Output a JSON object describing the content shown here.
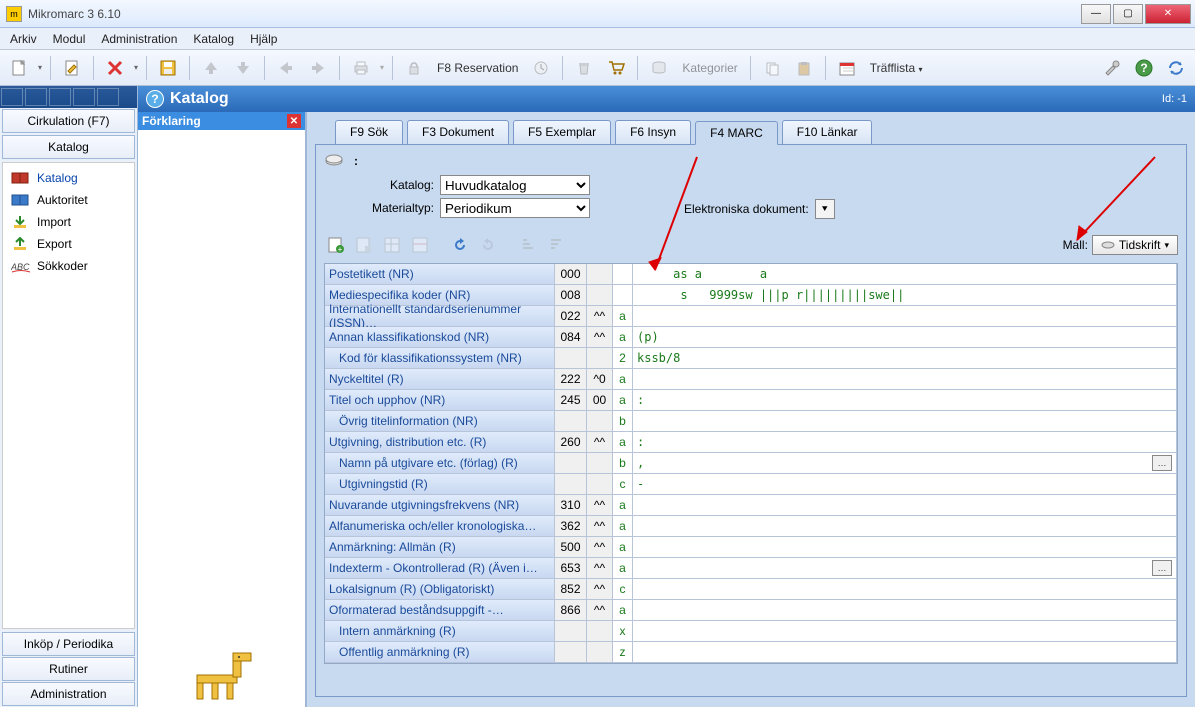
{
  "window": {
    "title": "Mikromarc 3 6.10",
    "id_label": "Id: -1"
  },
  "menu": [
    "Arkiv",
    "Modul",
    "Administration",
    "Katalog",
    "Hjälp"
  ],
  "toolbar": {
    "f8_reservation": "F8 Reservation",
    "kategorier": "Kategorier",
    "trafflista": "Träfflista"
  },
  "sidebar": {
    "tabs": {
      "cirkulation": "Cirkulation (F7)",
      "katalog": "Katalog"
    },
    "items": [
      {
        "label": "Katalog",
        "color": "#c0392b"
      },
      {
        "label": "Auktoritet",
        "color": "#2a6ab8"
      },
      {
        "label": "Import",
        "color": "#2a8a2a"
      },
      {
        "label": "Export",
        "color": "#2a8a2a"
      },
      {
        "label": "Sökkoder",
        "color": "#666"
      }
    ],
    "footer": [
      "Inköp / Periodika",
      "Rutiner",
      "Administration"
    ]
  },
  "help_panel": {
    "title": "Förklaring"
  },
  "content": {
    "heading": "Katalog",
    "tabs": [
      "F9 Sök",
      "F3 Dokument",
      "F5 Exemplar",
      "F6 Insyn",
      "F4 MARC",
      "F10 Länkar"
    ],
    "active_tab": 4,
    "meta": {
      "katalog_label": "Katalog:",
      "katalog_value": "Huvudkatalog",
      "materialtyp_label": "Materialtyp:",
      "materialtyp_value": "Periodikum",
      "elec_doc_label": "Elektroniska dokument:"
    },
    "mall": {
      "label": "Mall:",
      "value": "Tidskrift"
    }
  },
  "marc_rows": [
    {
      "label": "Postetikett (NR)",
      "tag": "000",
      "ind": "",
      "sf": "",
      "val": "     as a        a"
    },
    {
      "label": "Mediespecifika koder (NR)",
      "tag": "008",
      "ind": "",
      "sf": "",
      "val": "      s   9999sw |||p r|||||||||swe||"
    },
    {
      "label": "Internationellt standardserienummer (ISSN)…",
      "tag": "022",
      "ind": "^^",
      "sf": "a",
      "val": ""
    },
    {
      "label": "Annan klassifikationskod (NR)",
      "tag": "084",
      "ind": "^^",
      "sf": "a",
      "val": "(p)"
    },
    {
      "label": "Kod för klassifikationssystem (NR)",
      "sub": true,
      "tag": "",
      "ind": "",
      "sf": "2",
      "val": "kssb/8"
    },
    {
      "label": "Nyckeltitel (R)",
      "tag": "222",
      "ind": "^0",
      "sf": "a",
      "val": ""
    },
    {
      "label": "Titel och upphov (NR)",
      "tag": "245",
      "ind": "00",
      "sf": "a",
      "val": ":"
    },
    {
      "label": "Övrig titelinformation (NR)",
      "sub": true,
      "tag": "",
      "ind": "",
      "sf": "b",
      "val": ""
    },
    {
      "label": "Utgivning, distribution etc. (R)",
      "tag": "260",
      "ind": "^^",
      "sf": "a",
      "val": ":"
    },
    {
      "label": "Namn på utgivare etc. (förlag) (R)",
      "sub": true,
      "tag": "",
      "ind": "",
      "sf": "b",
      "val": ",",
      "ellipsis": true
    },
    {
      "label": "Utgivningstid (R)",
      "sub": true,
      "tag": "",
      "ind": "",
      "sf": "c",
      "val": "-"
    },
    {
      "label": "Nuvarande utgivningsfrekvens (NR)",
      "tag": "310",
      "ind": "^^",
      "sf": "a",
      "val": ""
    },
    {
      "label": "Alfanumeriska och/eller kronologiska…",
      "tag": "362",
      "ind": "^^",
      "sf": "a",
      "val": ""
    },
    {
      "label": "Anmärkning: Allmän (R)",
      "tag": "500",
      "ind": "^^",
      "sf": "a",
      "val": ""
    },
    {
      "label": "Indexterm - Okontrollerad (R) (Även i…",
      "tag": "653",
      "ind": "^^",
      "sf": "a",
      "val": "",
      "ellipsis": true
    },
    {
      "label": "Lokalsignum (R) (Obligatoriskt)",
      "tag": "852",
      "ind": "^^",
      "sf": "c",
      "val": ""
    },
    {
      "label": "Oformaterad beståndsuppgift -…",
      "tag": "866",
      "ind": "^^",
      "sf": "a",
      "val": ""
    },
    {
      "label": "Intern anmärkning (R)",
      "sub": true,
      "tag": "",
      "ind": "",
      "sf": "x",
      "val": ""
    },
    {
      "label": "Offentlig anmärkning (R)",
      "sub": true,
      "tag": "",
      "ind": "",
      "sf": "z",
      "val": ""
    }
  ]
}
